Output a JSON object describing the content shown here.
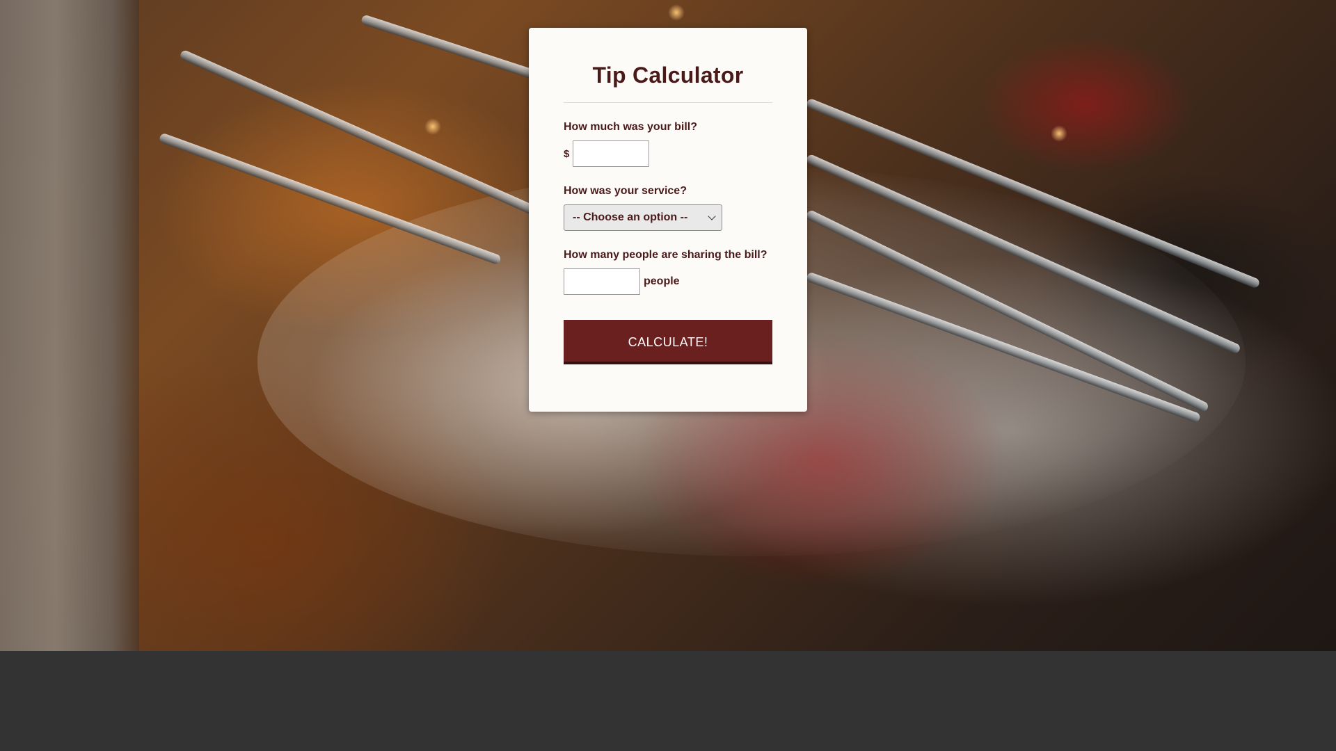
{
  "app": {
    "title": "Tip Calculator"
  },
  "form": {
    "bill": {
      "label": "How much was your bill?",
      "currency_symbol": "$",
      "value": "",
      "placeholder": ""
    },
    "service": {
      "label": "How was your service?",
      "selected_option": "-- Choose an option --",
      "icon": "chevron-down-icon"
    },
    "people": {
      "label": "How many people are sharing the bill?",
      "value": "",
      "placeholder": "",
      "unit": "people"
    },
    "calculate_label": "CALCULATE!"
  },
  "colors": {
    "title_text": "#4a1a1a",
    "button_bg": "#6b2020",
    "button_text": "#ffffff",
    "page_footer_bg": "#333333",
    "card_bg": "#fcfbf8"
  }
}
